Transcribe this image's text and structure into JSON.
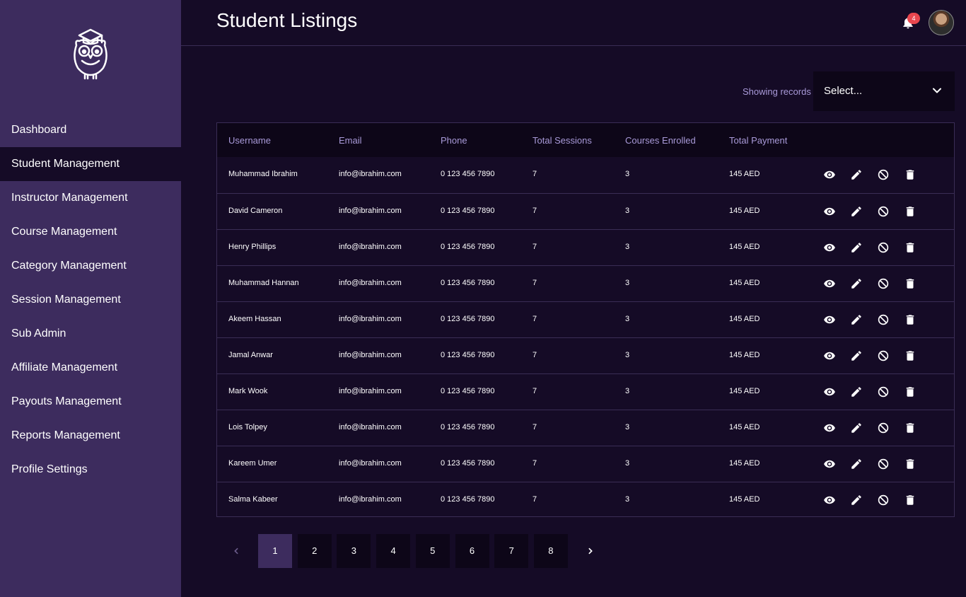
{
  "header": {
    "title": "Student Listings",
    "notification_count": "4"
  },
  "sidebar": {
    "items": [
      {
        "label": "Dashboard"
      },
      {
        "label": "Student Management"
      },
      {
        "label": "Instructor Management"
      },
      {
        "label": "Course Management"
      },
      {
        "label": "Category Management"
      },
      {
        "label": "Session Management"
      },
      {
        "label": "Sub Admin"
      },
      {
        "label": "Affiliate Management"
      },
      {
        "label": "Payouts Management"
      },
      {
        "label": "Reports Management"
      },
      {
        "label": "Profile Settings"
      }
    ],
    "active_index": 1
  },
  "filter": {
    "label": "Showing records",
    "select_value": "Select..."
  },
  "table": {
    "columns": [
      "Username",
      "Email",
      "Phone",
      "Total Sessions",
      "Courses Enrolled",
      "Total Payment"
    ],
    "rows": [
      [
        "Muhammad Ibrahim",
        "info@ibrahim.com",
        "0 123 456 7890",
        "7",
        "3",
        "145 AED"
      ],
      [
        "David Cameron",
        "info@ibrahim.com",
        "0 123 456 7890",
        "7",
        "3",
        "145 AED"
      ],
      [
        "Henry Phillips",
        "info@ibrahim.com",
        "0 123 456 7890",
        "7",
        "3",
        "145 AED"
      ],
      [
        "Muhammad Hannan",
        "info@ibrahim.com",
        "0 123 456 7890",
        "7",
        "3",
        "145 AED"
      ],
      [
        "Akeem Hassan",
        "info@ibrahim.com",
        "0 123 456 7890",
        "7",
        "3",
        "145 AED"
      ],
      [
        "Jamal Anwar",
        "info@ibrahim.com",
        "0 123 456 7890",
        "7",
        "3",
        "145 AED"
      ],
      [
        "Mark Wook",
        "info@ibrahim.com",
        "0 123 456 7890",
        "7",
        "3",
        "145 AED"
      ],
      [
        "Lois Tolpey",
        "info@ibrahim.com",
        "0 123 456 7890",
        "7",
        "3",
        "145 AED"
      ],
      [
        "Kareem Umer",
        "info@ibrahim.com",
        "0 123 456 7890",
        "7",
        "3",
        "145 AED"
      ],
      [
        "Salma Kabeer",
        "info@ibrahim.com",
        "0 123 456 7890",
        "7",
        "3",
        "145 AED"
      ]
    ],
    "row_actions": [
      "eye-icon",
      "pencil-icon",
      "block-icon",
      "trash-icon"
    ]
  },
  "pagination": {
    "pages": [
      "1",
      "2",
      "3",
      "4",
      "5",
      "6",
      "7",
      "8"
    ],
    "current": "1",
    "prev_icon": "chevron-left-icon",
    "next_icon": "chevron-right-icon"
  },
  "colors": {
    "sidebar_bg": "#3d2c5e",
    "page_bg": "#150b26",
    "header_text": "#a99ad9",
    "badge": "#e8464e"
  }
}
